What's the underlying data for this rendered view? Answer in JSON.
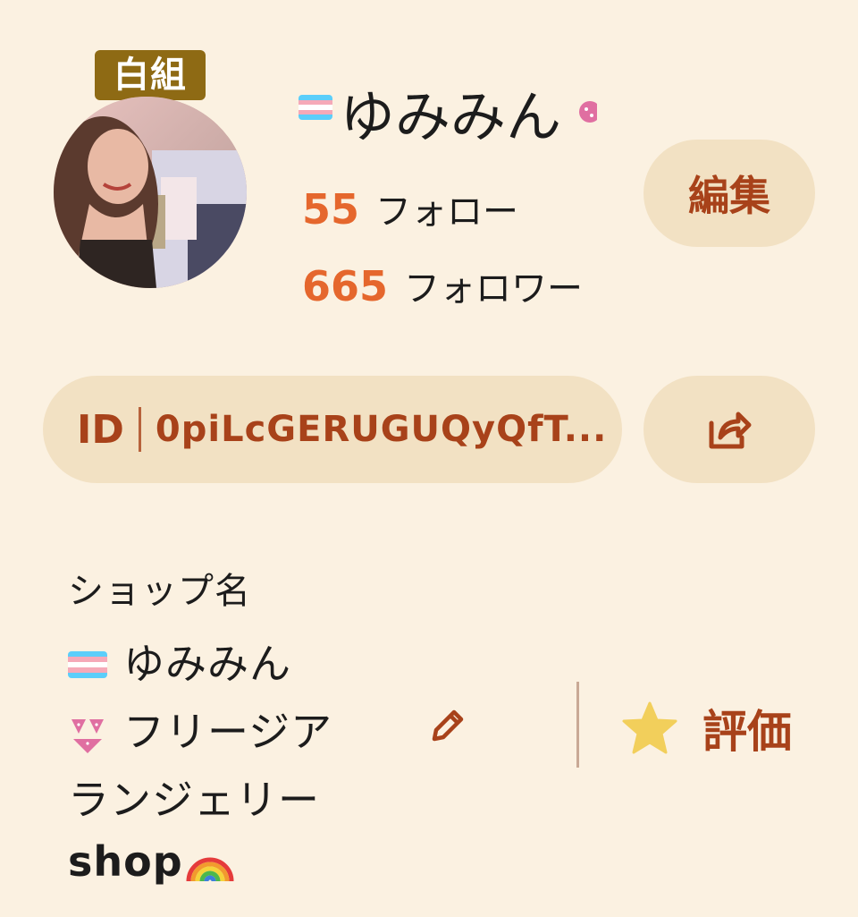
{
  "profile": {
    "badge": "白組",
    "name": "ゆみみん",
    "follow_count": "55",
    "follow_label": "フォロー",
    "follower_count": "665",
    "follower_label": "フォロワー",
    "edit_label": "編集"
  },
  "user_id": {
    "label": "ID",
    "value": "0piLcGERUGUQyQfT..."
  },
  "shop": {
    "label": "ショップ名",
    "line1": "ゆみみん",
    "line2": "フリージア",
    "line3": "ランジェリー",
    "line4": "shop"
  },
  "rating": {
    "label": "評価"
  },
  "colors": {
    "background": "#FBF1E1",
    "pill": "#F2E1C3",
    "accent": "#A8421A",
    "count": "#E5672D",
    "badge": "#8E6A14",
    "star": "#F2CF5B"
  },
  "icons": [
    "transgender-flag-icon",
    "bikini-icon",
    "share-icon",
    "pencil-icon",
    "star-icon",
    "rainbow-icon"
  ]
}
